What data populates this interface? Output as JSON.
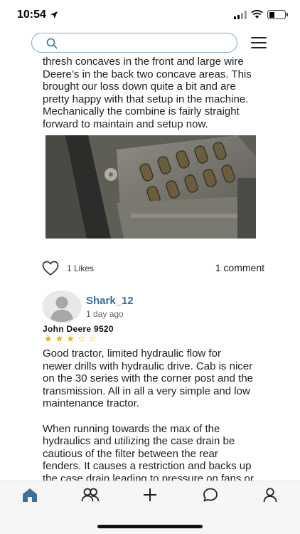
{
  "status_bar": {
    "time": "10:54"
  },
  "search": {
    "placeholder": "",
    "value": ""
  },
  "post": {
    "text": "thresh concaves in the front and large wire\nDeere’s in the back two concave areas. This\nbrought our loss down quite a bit and are\npretty happy with that setup in the machine.\nMechanically the combine is fairly straight\nforward to maintain and setup now.",
    "likes_label": "1 Likes",
    "comments_label": "1 comment"
  },
  "comment": {
    "author": "Shark_12",
    "time_ago": "1 day ago",
    "machine": "John Deere 9520",
    "rating": 3,
    "rating_max": 5,
    "text": "Good tractor, limited hydraulic flow for\nnewer drills with hydraulic drive. Cab is nicer\non the 30 series with the corner post and the\ntransmission. All in all a very simple and low\nmaintenance tractor.\n\nWhen running towards the max of the\nhydraulics and utilizing the case drain be\ncautious of the filter between the rear\nfenders. It causes a restriction and backs up\nthe case drain leading to pressure on fans or"
  },
  "tabbar": {
    "items": [
      "home-icon",
      "people-icon",
      "plus-icon",
      "chat-icon",
      "profile-icon"
    ],
    "active": "home-icon"
  },
  "colors": {
    "accent": "#3a6f9e",
    "search_border": "#7fa7c9",
    "star": "#e6b31e",
    "tab_active": "#3f6f95"
  }
}
